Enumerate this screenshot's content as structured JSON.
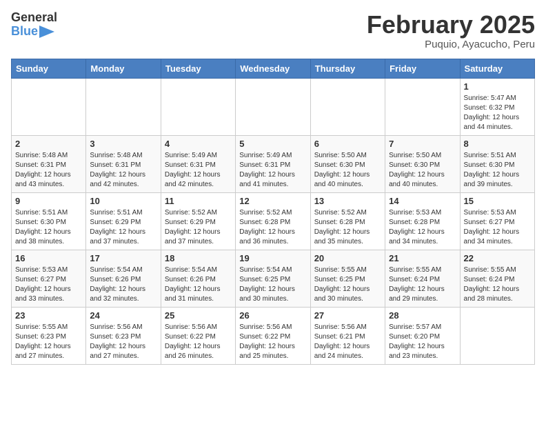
{
  "header": {
    "logo": {
      "general": "General",
      "blue": "Blue"
    },
    "title": "February 2025",
    "location": "Puquio, Ayacucho, Peru"
  },
  "calendar": {
    "weekdays": [
      "Sunday",
      "Monday",
      "Tuesday",
      "Wednesday",
      "Thursday",
      "Friday",
      "Saturday"
    ],
    "weeks": [
      [
        {
          "day": "",
          "info": ""
        },
        {
          "day": "",
          "info": ""
        },
        {
          "day": "",
          "info": ""
        },
        {
          "day": "",
          "info": ""
        },
        {
          "day": "",
          "info": ""
        },
        {
          "day": "",
          "info": ""
        },
        {
          "day": "1",
          "info": "Sunrise: 5:47 AM\nSunset: 6:32 PM\nDaylight: 12 hours and 44 minutes."
        }
      ],
      [
        {
          "day": "2",
          "info": "Sunrise: 5:48 AM\nSunset: 6:31 PM\nDaylight: 12 hours and 43 minutes."
        },
        {
          "day": "3",
          "info": "Sunrise: 5:48 AM\nSunset: 6:31 PM\nDaylight: 12 hours and 42 minutes."
        },
        {
          "day": "4",
          "info": "Sunrise: 5:49 AM\nSunset: 6:31 PM\nDaylight: 12 hours and 42 minutes."
        },
        {
          "day": "5",
          "info": "Sunrise: 5:49 AM\nSunset: 6:31 PM\nDaylight: 12 hours and 41 minutes."
        },
        {
          "day": "6",
          "info": "Sunrise: 5:50 AM\nSunset: 6:30 PM\nDaylight: 12 hours and 40 minutes."
        },
        {
          "day": "7",
          "info": "Sunrise: 5:50 AM\nSunset: 6:30 PM\nDaylight: 12 hours and 40 minutes."
        },
        {
          "day": "8",
          "info": "Sunrise: 5:51 AM\nSunset: 6:30 PM\nDaylight: 12 hours and 39 minutes."
        }
      ],
      [
        {
          "day": "9",
          "info": "Sunrise: 5:51 AM\nSunset: 6:30 PM\nDaylight: 12 hours and 38 minutes."
        },
        {
          "day": "10",
          "info": "Sunrise: 5:51 AM\nSunset: 6:29 PM\nDaylight: 12 hours and 37 minutes."
        },
        {
          "day": "11",
          "info": "Sunrise: 5:52 AM\nSunset: 6:29 PM\nDaylight: 12 hours and 37 minutes."
        },
        {
          "day": "12",
          "info": "Sunrise: 5:52 AM\nSunset: 6:28 PM\nDaylight: 12 hours and 36 minutes."
        },
        {
          "day": "13",
          "info": "Sunrise: 5:52 AM\nSunset: 6:28 PM\nDaylight: 12 hours and 35 minutes."
        },
        {
          "day": "14",
          "info": "Sunrise: 5:53 AM\nSunset: 6:28 PM\nDaylight: 12 hours and 34 minutes."
        },
        {
          "day": "15",
          "info": "Sunrise: 5:53 AM\nSunset: 6:27 PM\nDaylight: 12 hours and 34 minutes."
        }
      ],
      [
        {
          "day": "16",
          "info": "Sunrise: 5:53 AM\nSunset: 6:27 PM\nDaylight: 12 hours and 33 minutes."
        },
        {
          "day": "17",
          "info": "Sunrise: 5:54 AM\nSunset: 6:26 PM\nDaylight: 12 hours and 32 minutes."
        },
        {
          "day": "18",
          "info": "Sunrise: 5:54 AM\nSunset: 6:26 PM\nDaylight: 12 hours and 31 minutes."
        },
        {
          "day": "19",
          "info": "Sunrise: 5:54 AM\nSunset: 6:25 PM\nDaylight: 12 hours and 30 minutes."
        },
        {
          "day": "20",
          "info": "Sunrise: 5:55 AM\nSunset: 6:25 PM\nDaylight: 12 hours and 30 minutes."
        },
        {
          "day": "21",
          "info": "Sunrise: 5:55 AM\nSunset: 6:24 PM\nDaylight: 12 hours and 29 minutes."
        },
        {
          "day": "22",
          "info": "Sunrise: 5:55 AM\nSunset: 6:24 PM\nDaylight: 12 hours and 28 minutes."
        }
      ],
      [
        {
          "day": "23",
          "info": "Sunrise: 5:55 AM\nSunset: 6:23 PM\nDaylight: 12 hours and 27 minutes."
        },
        {
          "day": "24",
          "info": "Sunrise: 5:56 AM\nSunset: 6:23 PM\nDaylight: 12 hours and 27 minutes."
        },
        {
          "day": "25",
          "info": "Sunrise: 5:56 AM\nSunset: 6:22 PM\nDaylight: 12 hours and 26 minutes."
        },
        {
          "day": "26",
          "info": "Sunrise: 5:56 AM\nSunset: 6:22 PM\nDaylight: 12 hours and 25 minutes."
        },
        {
          "day": "27",
          "info": "Sunrise: 5:56 AM\nSunset: 6:21 PM\nDaylight: 12 hours and 24 minutes."
        },
        {
          "day": "28",
          "info": "Sunrise: 5:57 AM\nSunset: 6:20 PM\nDaylight: 12 hours and 23 minutes."
        },
        {
          "day": "",
          "info": ""
        }
      ]
    ]
  }
}
